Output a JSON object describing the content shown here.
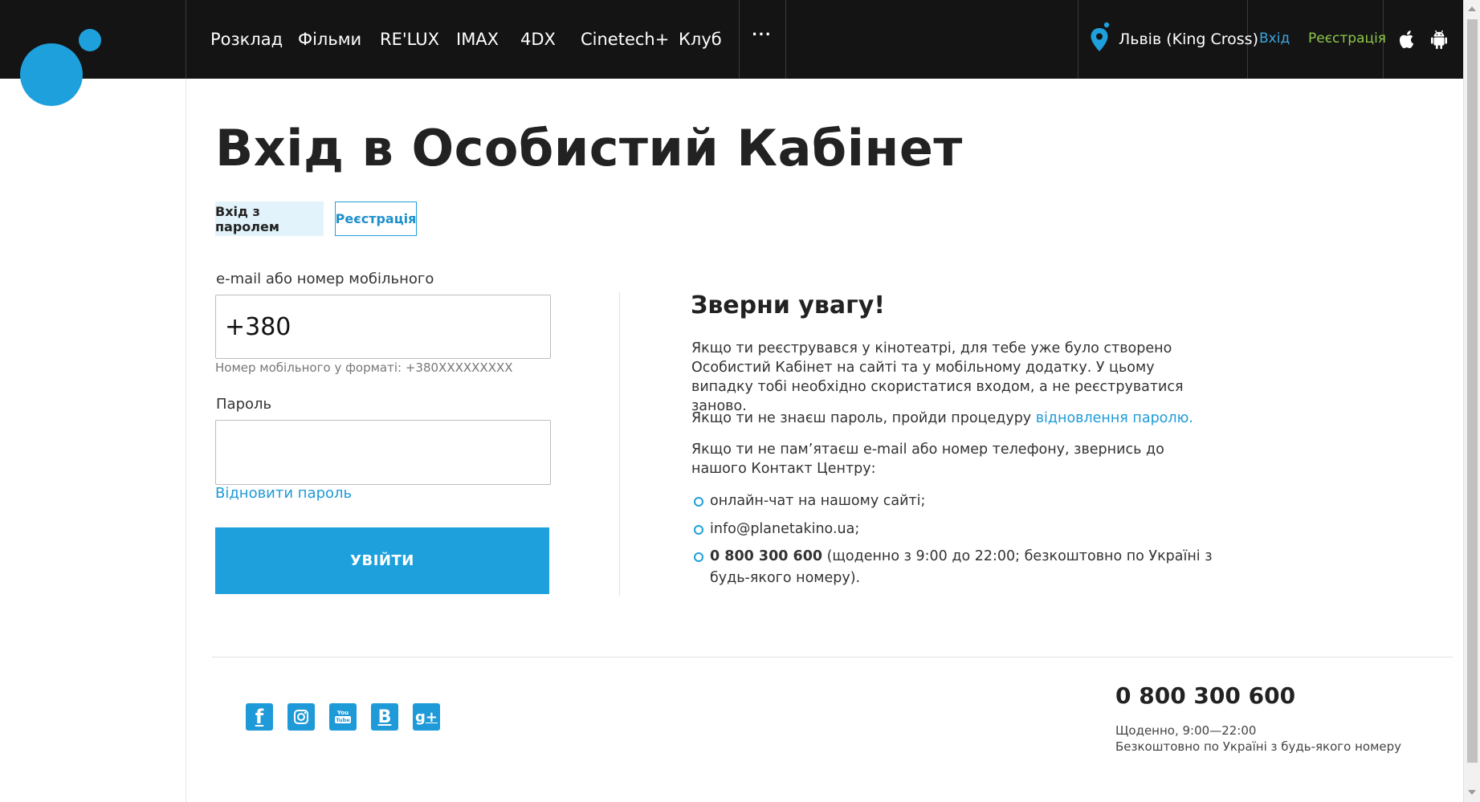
{
  "nav": {
    "items": [
      "Розклад",
      "Фільми",
      "RE'LUX",
      "IMAX",
      "4DX",
      "Cinetech+",
      "Клуб"
    ],
    "more": "···"
  },
  "header": {
    "city": "Львів (King Cross)",
    "login": "Вхід",
    "register": "Реєстрація",
    "apps": [
      "apple-icon",
      "android-icon"
    ]
  },
  "page": {
    "title": "Вхід в Особистий Кабінет",
    "tabs": {
      "password_login": "Вхід з паролем",
      "register": "Реєстрація"
    }
  },
  "form": {
    "login_label": "e-mail або номер мобільного",
    "login_value": "+380",
    "login_hint": "Номер мобільного у форматі: +380XXXXXXXXX",
    "password_label": "Пароль",
    "password_value": "",
    "restore_link": "Відновити пароль",
    "submit": "УВІЙТИ"
  },
  "notice": {
    "title": "Зверни увагу!",
    "p1": "Якщо ти реєструвався у кінотеатрі, для тебе уже було створено Особистий Кабінет на сайті та у мобільному додатку. У цьому випадку тобі необхідно скористатися входом, а не реєструватися заново.",
    "p2_before": "Якщо ти не знаєш пароль, пройди процедуру ",
    "p2_link": "відновлення паролю.",
    "p3": "Якщо ти не пам’ятаєш e-mail або номер телефону, звернись до нашого Контакт Центру:",
    "bullets": {
      "chat": "онлайн-чат на нашому сайті;",
      "email": "info@planetakino.ua;",
      "phone_bold": "0 800 300 600",
      "phone_rest": " (щоденно з 9:00 до 22:00; безкоштовно по Україні з будь-якого номеру)."
    }
  },
  "footer": {
    "socials": [
      "facebook-icon",
      "instagram-icon",
      "youtube-icon",
      "vk-icon",
      "google-plus-icon"
    ],
    "phone": "0 800 300 600",
    "hours": "Щоденно, 9:00—22:00",
    "free": "Безкоштовно по Україні з будь-якого номеру"
  },
  "colors": {
    "accent": "#1ea0dc",
    "header_bg": "#141414",
    "register_green": "#8ec64a"
  }
}
